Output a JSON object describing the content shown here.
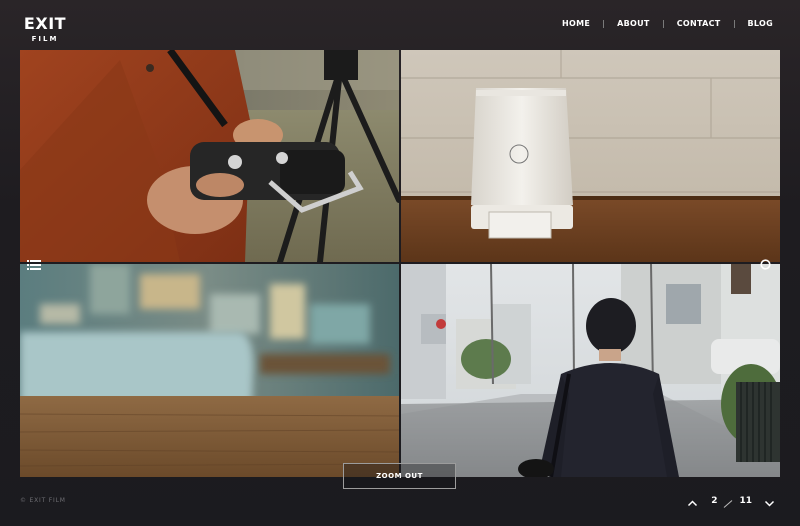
{
  "brand": {
    "logo_main": "EXIT",
    "logo_sub": "FILM"
  },
  "nav": {
    "items": [
      {
        "label": "HOME"
      },
      {
        "label": "ABOUT"
      },
      {
        "label": "CONTACT"
      },
      {
        "label": "BLOG"
      }
    ]
  },
  "gallery": {
    "tiles": [
      {
        "subject": "hands holding drone remote controller in front of tripod"
      },
      {
        "subject": "white cylindrical device on wooden table"
      },
      {
        "subject": "blurred wooden table and bookshelf"
      },
      {
        "subject": "businessman walking down residential street"
      }
    ],
    "left_icon": "list-icon",
    "right_icon": "circle-icon"
  },
  "zoom": {
    "label": "ZOOM OUT"
  },
  "footer": {
    "copyright": "© EXIT FILM"
  },
  "pager": {
    "current": "2",
    "total": "11",
    "prev_icon": "chevron-up-icon",
    "next_icon": "chevron-down-icon"
  },
  "colors": {
    "background": "#1d1c20",
    "text": "#ffffff",
    "muted": "#6f6f74"
  }
}
